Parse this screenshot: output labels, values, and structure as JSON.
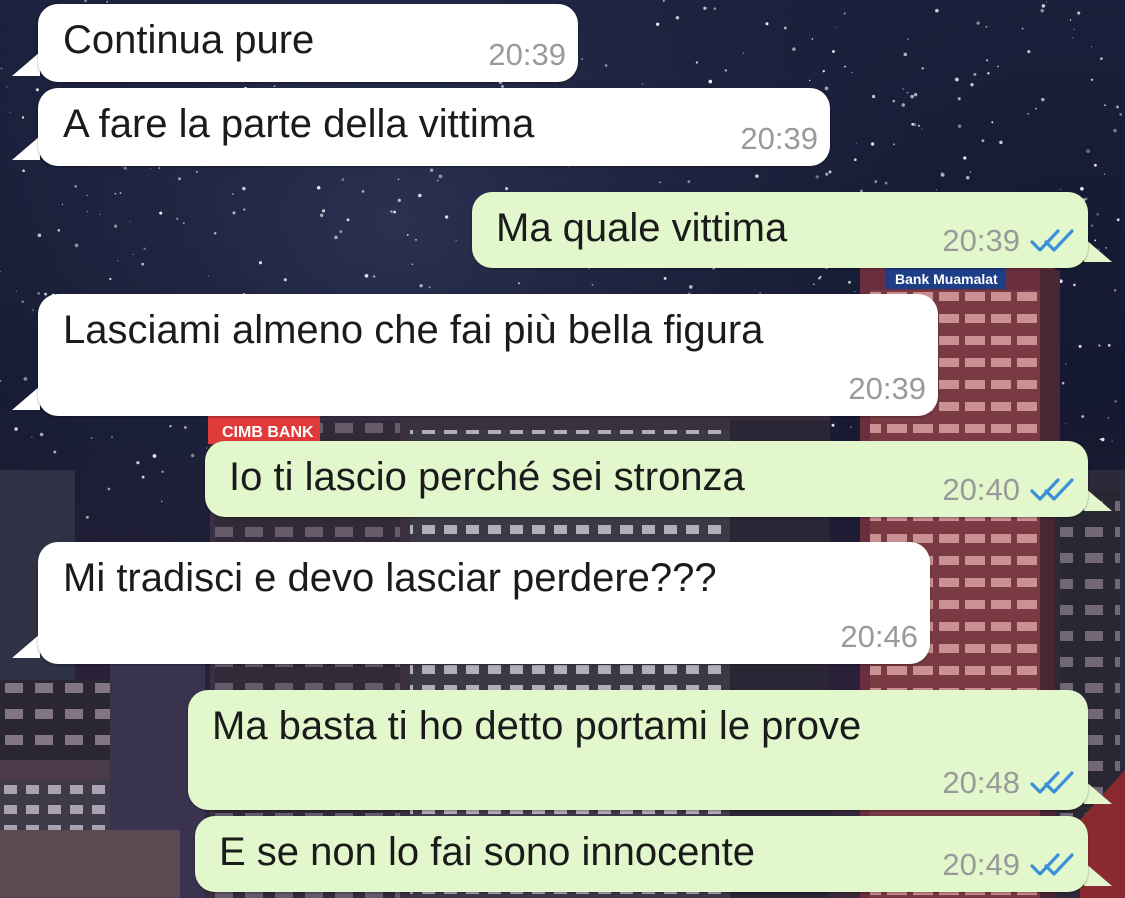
{
  "chat": {
    "messages": [
      {
        "direction": "incoming",
        "text": "Continua pure",
        "time": "20:39"
      },
      {
        "direction": "incoming",
        "text": "A fare la parte della vittima",
        "time": "20:39"
      },
      {
        "direction": "outgoing",
        "text": "Ma quale vittima",
        "time": "20:39",
        "status": "read"
      },
      {
        "direction": "incoming",
        "text": "Lasciami almeno che fai più bella figura",
        "time": "20:39"
      },
      {
        "direction": "outgoing",
        "text": "Io ti lascio perché sei stronza",
        "time": "20:40",
        "status": "read"
      },
      {
        "direction": "incoming",
        "text": "Mi tradisci e devo lasciar perdere???",
        "time": "20:46"
      },
      {
        "direction": "outgoing",
        "text": "Ma basta ti ho detto portami le prove",
        "time": "20:48",
        "status": "read"
      },
      {
        "direction": "outgoing",
        "text": "E se non lo fai sono innocente",
        "time": "20:49",
        "status": "read"
      }
    ]
  },
  "wallpaper": {
    "sign_left": "CIMB BANK",
    "sign_right": "Bank Muamalat"
  },
  "colors": {
    "incoming_bubble": "#ffffff",
    "outgoing_bubble": "#e2f7cb",
    "timestamp": "#9a9a9a",
    "read_ticks": "#3a8fd8",
    "night_sky": "#141a35"
  },
  "icons": {
    "read_receipt": "double-check-icon"
  }
}
